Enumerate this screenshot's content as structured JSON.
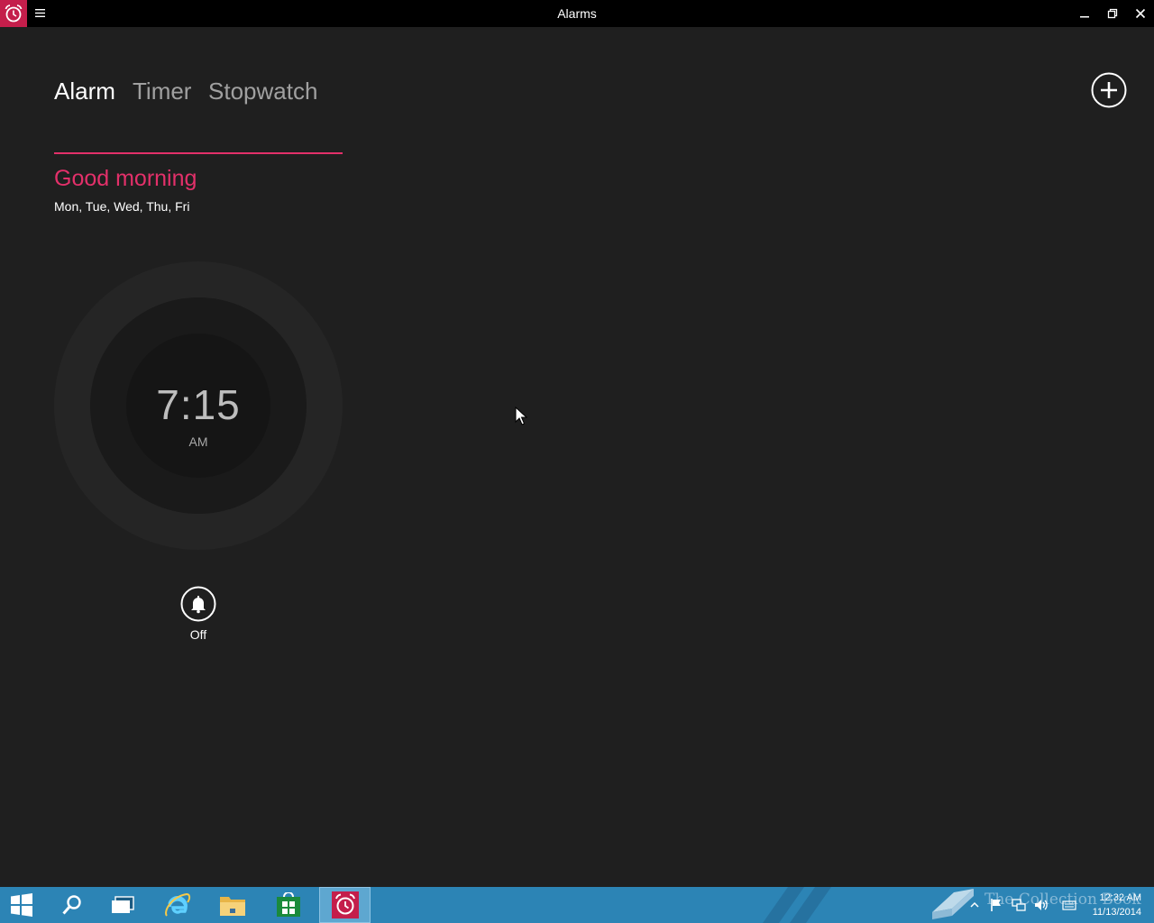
{
  "window": {
    "title": "Alarms",
    "app_icon": "alarm-clock-icon",
    "menu_icon": "hamburger-menu-icon",
    "controls": [
      "minimize-icon",
      "restore-icon",
      "close-icon"
    ]
  },
  "tabs": [
    {
      "label": "Alarm",
      "active": true
    },
    {
      "label": "Timer",
      "active": false
    },
    {
      "label": "Stopwatch",
      "active": false
    }
  ],
  "add_button": {
    "icon": "plus-circle-icon"
  },
  "alarm": {
    "name": "Good morning",
    "days": "Mon, Tue, Wed, Thu, Fri",
    "time": "7:15",
    "period": "AM",
    "toggle_icon": "bell-icon",
    "status": "Off"
  },
  "colors": {
    "accent": "#e3306a",
    "background": "#1f1f1f",
    "titlebar": "#000000",
    "taskbar": "#2c84b5"
  },
  "taskbar": {
    "items": [
      {
        "icon": "windows-start-icon"
      },
      {
        "icon": "search-icon"
      },
      {
        "icon": "task-view-icon"
      },
      {
        "icon": "internet-explorer-icon"
      },
      {
        "icon": "file-explorer-icon"
      },
      {
        "icon": "store-icon"
      },
      {
        "icon": "alarm-clock-icon",
        "active": true
      }
    ],
    "watermark": "The Collection Book",
    "tray_icons": [
      "chevron-up-icon",
      "flag-icon",
      "network-icon",
      "volume-icon",
      "keyboard-icon"
    ],
    "clock_time": "12:32 AM",
    "clock_date": "11/13/2014"
  }
}
